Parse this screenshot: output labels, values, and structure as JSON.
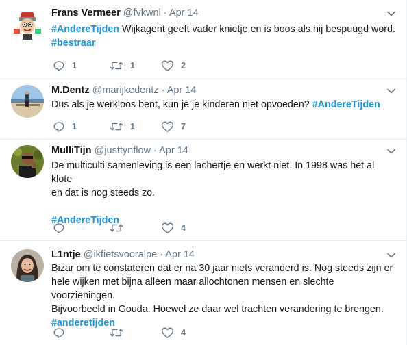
{
  "tweets": [
    {
      "name": "Frans Vermeer",
      "handle": "@fvkwnl",
      "sep": "·",
      "time": "Apr 14",
      "line1_tag": "#AndereTijden",
      "line1_text": " Wijkagent geeft vader knietje en is boos als hij bespuugd word.",
      "line2_tag": "#bestraar",
      "replies": "1",
      "retweets": "1",
      "likes": "2"
    },
    {
      "name": "M.Dentz",
      "handle": "@marijkedentz",
      "sep": "·",
      "time": "Apr 14",
      "line1_text": "Dus als je werkloos  bent, kun je je kinderen niet opvoeden?  ",
      "line1_tag": "#AndereTijden",
      "replies": "1",
      "retweets": "1",
      "likes": "7"
    },
    {
      "name": "MulliTijn",
      "handle": "@justtynflow",
      "sep": "·",
      "time": "Apr 14",
      "line1": "De multiculti samenleving is een lachertje en werkt niet. In 1998 was het al klote",
      "line2": "en dat is nog steeds zo.",
      "tag": "#AndereTijden",
      "replies": "",
      "retweets": "",
      "likes": "4"
    },
    {
      "name": "L1ntje",
      "handle": "@ikfietsvooralpe",
      "sep": "·",
      "time": "Apr 14",
      "line1": "Bizar om te constateren dat er na 30 jaar niets veranderd is. Nog steeds zijn er",
      "line2": "hele wijken met bijna alleen maar allochtonen mensen en slechte voorzieningen.",
      "line3": "Bijvoorbeeld in Gouda. Hoewel ze daar wel trachten verandering te brengen.",
      "tag": "#anderetijden",
      "replies": "",
      "retweets": "",
      "likes": "4"
    }
  ]
}
